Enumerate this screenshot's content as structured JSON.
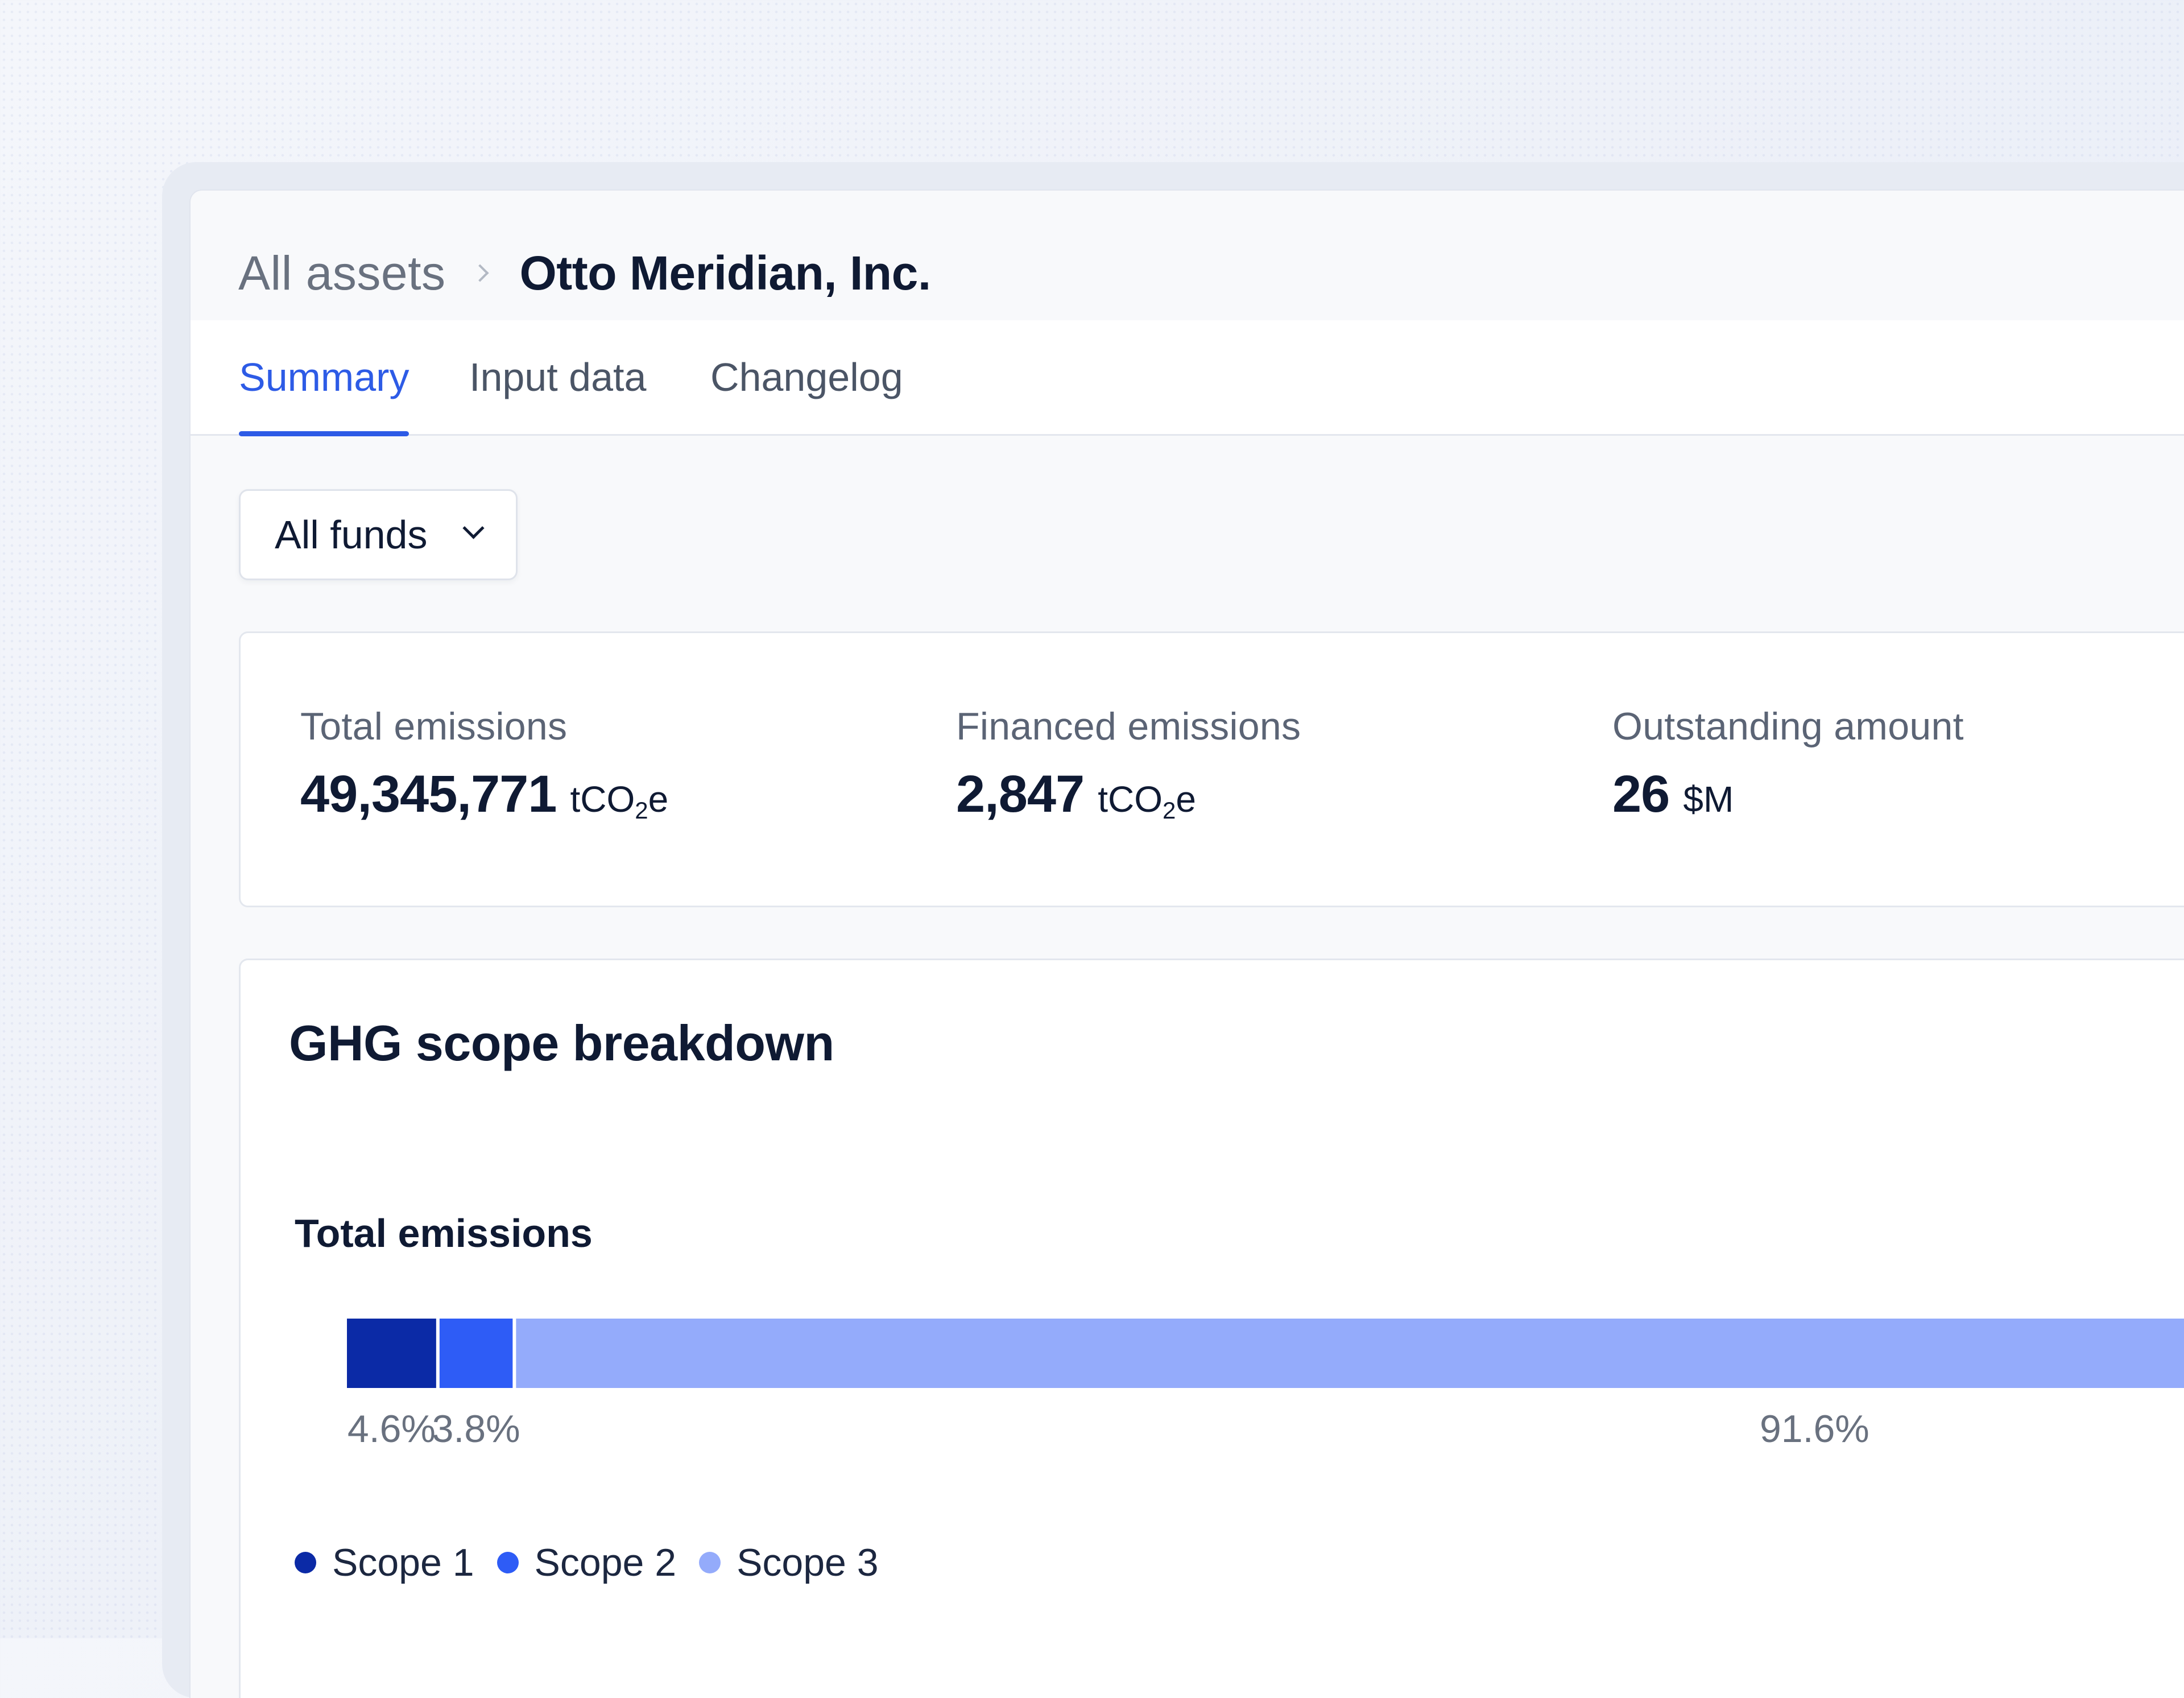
{
  "breadcrumb": {
    "root": "All assets",
    "current": "Otto Meridian, Inc."
  },
  "tabs": [
    {
      "label": "Summary",
      "active": true
    },
    {
      "label": "Input data",
      "active": false
    },
    {
      "label": "Changelog",
      "active": false
    }
  ],
  "fund_select": {
    "value": "All funds"
  },
  "metrics": [
    {
      "label": "Total emissions",
      "value": "49,345,771",
      "unit_prefix": "tCO",
      "unit_sub": "2",
      "unit_suffix": "e"
    },
    {
      "label": "Financed emissions",
      "value": "2,847",
      "unit_prefix": "tCO",
      "unit_sub": "2",
      "unit_suffix": "e"
    },
    {
      "label": "Outstanding amount",
      "value": "26",
      "unit_prefix": "$M",
      "unit_sub": "",
      "unit_suffix": ""
    }
  ],
  "breakdown": {
    "title": "GHG scope breakdown",
    "chart_label": "Total emissions"
  },
  "chart_data": {
    "type": "bar",
    "orientation": "horizontal-stacked",
    "categories": [
      "Total emissions"
    ],
    "series": [
      {
        "name": "Scope 1",
        "values": [
          4.6
        ],
        "label": "4.6%",
        "color": "#0b2aa6"
      },
      {
        "name": "Scope 2",
        "values": [
          3.8
        ],
        "label": "3.8%",
        "color": "#2e5cf6"
      },
      {
        "name": "Scope 3",
        "values": [
          91.6
        ],
        "label": "91.6%",
        "color": "#94abfb"
      }
    ],
    "unit": "%",
    "xlim": [
      0,
      100
    ]
  },
  "legend": [
    {
      "label": "Scope 1",
      "color": "#0b2aa6"
    },
    {
      "label": "Scope 2",
      "color": "#2e5cf6"
    },
    {
      "label": "Scope 3",
      "color": "#94abfb"
    }
  ]
}
